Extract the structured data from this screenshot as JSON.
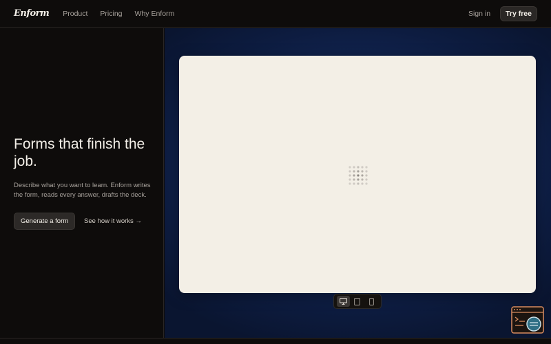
{
  "nav": {
    "logo": "Enform",
    "links": [
      "Product",
      "Pricing",
      "Why Enform"
    ],
    "sign_in": "Sign in",
    "try_free": "Try free"
  },
  "hero": {
    "headline": "Forms that finish the job.",
    "description": "Describe what you want to learn. Enform writes the form, reads every answer, drafts the deck.",
    "primary_cta": "Generate a form",
    "secondary_cta": "See how it works →"
  },
  "preview": {
    "state": "loading",
    "devices": [
      {
        "name": "desktop",
        "active": true
      },
      {
        "name": "tablet",
        "active": false
      },
      {
        "name": "mobile",
        "active": false
      }
    ]
  },
  "colors": {
    "background": "#0e0c0b",
    "text_primary": "#f3efe8",
    "text_muted": "#a8a29c",
    "preview_bg": "#f3efe6",
    "accent_blue": "#1e3a7a",
    "floating_icon_accent": "#d98c5f"
  },
  "icons": [
    "desktop-icon",
    "tablet-icon",
    "mobile-icon",
    "loading-dots-icon",
    "terminal-chat-icon"
  ]
}
